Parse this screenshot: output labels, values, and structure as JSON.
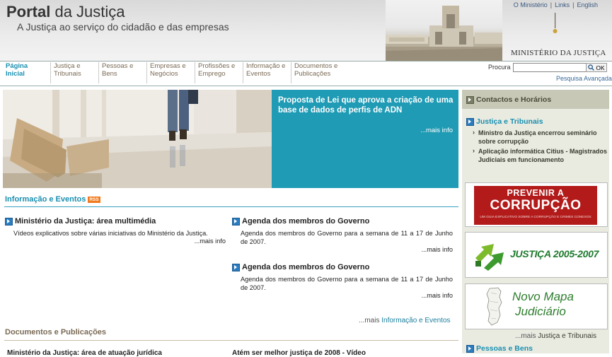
{
  "header": {
    "title_bold": "Portal",
    "title_rest": " da Justiça",
    "tagline": "A Justiça ao serviço do cidadão e das empresas",
    "top_links": [
      "O Ministério",
      "Links",
      "English"
    ],
    "ministry_name": "MINISTÉRIO DA JUSTIÇA"
  },
  "nav": {
    "items": [
      {
        "line1": "Página",
        "line2": "Inicial"
      },
      {
        "line1": "Justiça e",
        "line2": "Tribunais"
      },
      {
        "line1": "Pessoas e",
        "line2": "Bens"
      },
      {
        "line1": "Empresas e",
        "line2": "Negócios"
      },
      {
        "line1": "Profissões e",
        "line2": "Emprego"
      },
      {
        "line1": "Informação e",
        "line2": "Eventos"
      },
      {
        "line1": "Documentos e",
        "line2": "Publicações"
      }
    ],
    "search_label": "Procura",
    "search_value": "",
    "search_button": "OK",
    "advanced_search": "Pesquisa Avançada"
  },
  "banner": {
    "headline": "Proposta de Lei que aprova a criação de uma base de dados de perfis de ADN",
    "more": "...mais info"
  },
  "info_events": {
    "title": "Informação e Eventos",
    "rss": "RSS",
    "items": [
      {
        "title": "Ministério da Justiça: área multimédia",
        "text": "Vídeos explicativos sobre várias iniciativas do Ministério da Justiça.",
        "more": "...mais info"
      },
      {
        "title": "Agenda dos membros do Governo",
        "text": "Agenda dos membros do Governo para a semana de 11 a 17 de Junho de 2007.",
        "more": "...mais info"
      },
      {
        "title": "Agenda dos membros do Governo",
        "text": "Agenda dos membros do Governo para a semana de 11 a 17 de Junho de 2007.",
        "more": "...mais info"
      }
    ],
    "more_prefix": "...mais ",
    "more_link": "Informação e Eventos"
  },
  "documents": {
    "title": "Documentos e Publicações",
    "peek1": "Ministério da Justiça: área de atuação jurídica",
    "peek2": "Atém ser melhor justiça de 2008 - Vídeo"
  },
  "sidebar": {
    "contacts_title": "Contactos e Horários",
    "justice_title": "Justiça e Tribunais",
    "justice_items": [
      "Ministro da Justiça encerrou seminário sobre corrupção",
      "Aplicação informática Citius - Magistrados Judiciais em funcionamento"
    ],
    "promo1_line1": "PREVENIR A",
    "promo1_line2": "CORRUPÇÃO",
    "promo1_line3": "UM GUIA EXPLICATIVO SOBRE A CORRUPÇÃO E CRIMES CONEXOS",
    "promo2_text": "JUSTIÇA 2005-2007",
    "promo3_line1": "Novo Mapa",
    "promo3_line2": "Judiciário",
    "more_prefix": "...mais ",
    "more_link": "Justiça e Tribunais",
    "people_title": "Pessoas e Bens"
  },
  "colors": {
    "accent_teal": "#1f9bb5",
    "nav_text": "#7a6a55",
    "sidebar_bg": "#e9ebe1",
    "promo_red": "#b31b1b",
    "promo_green": "#1f7a2e"
  }
}
